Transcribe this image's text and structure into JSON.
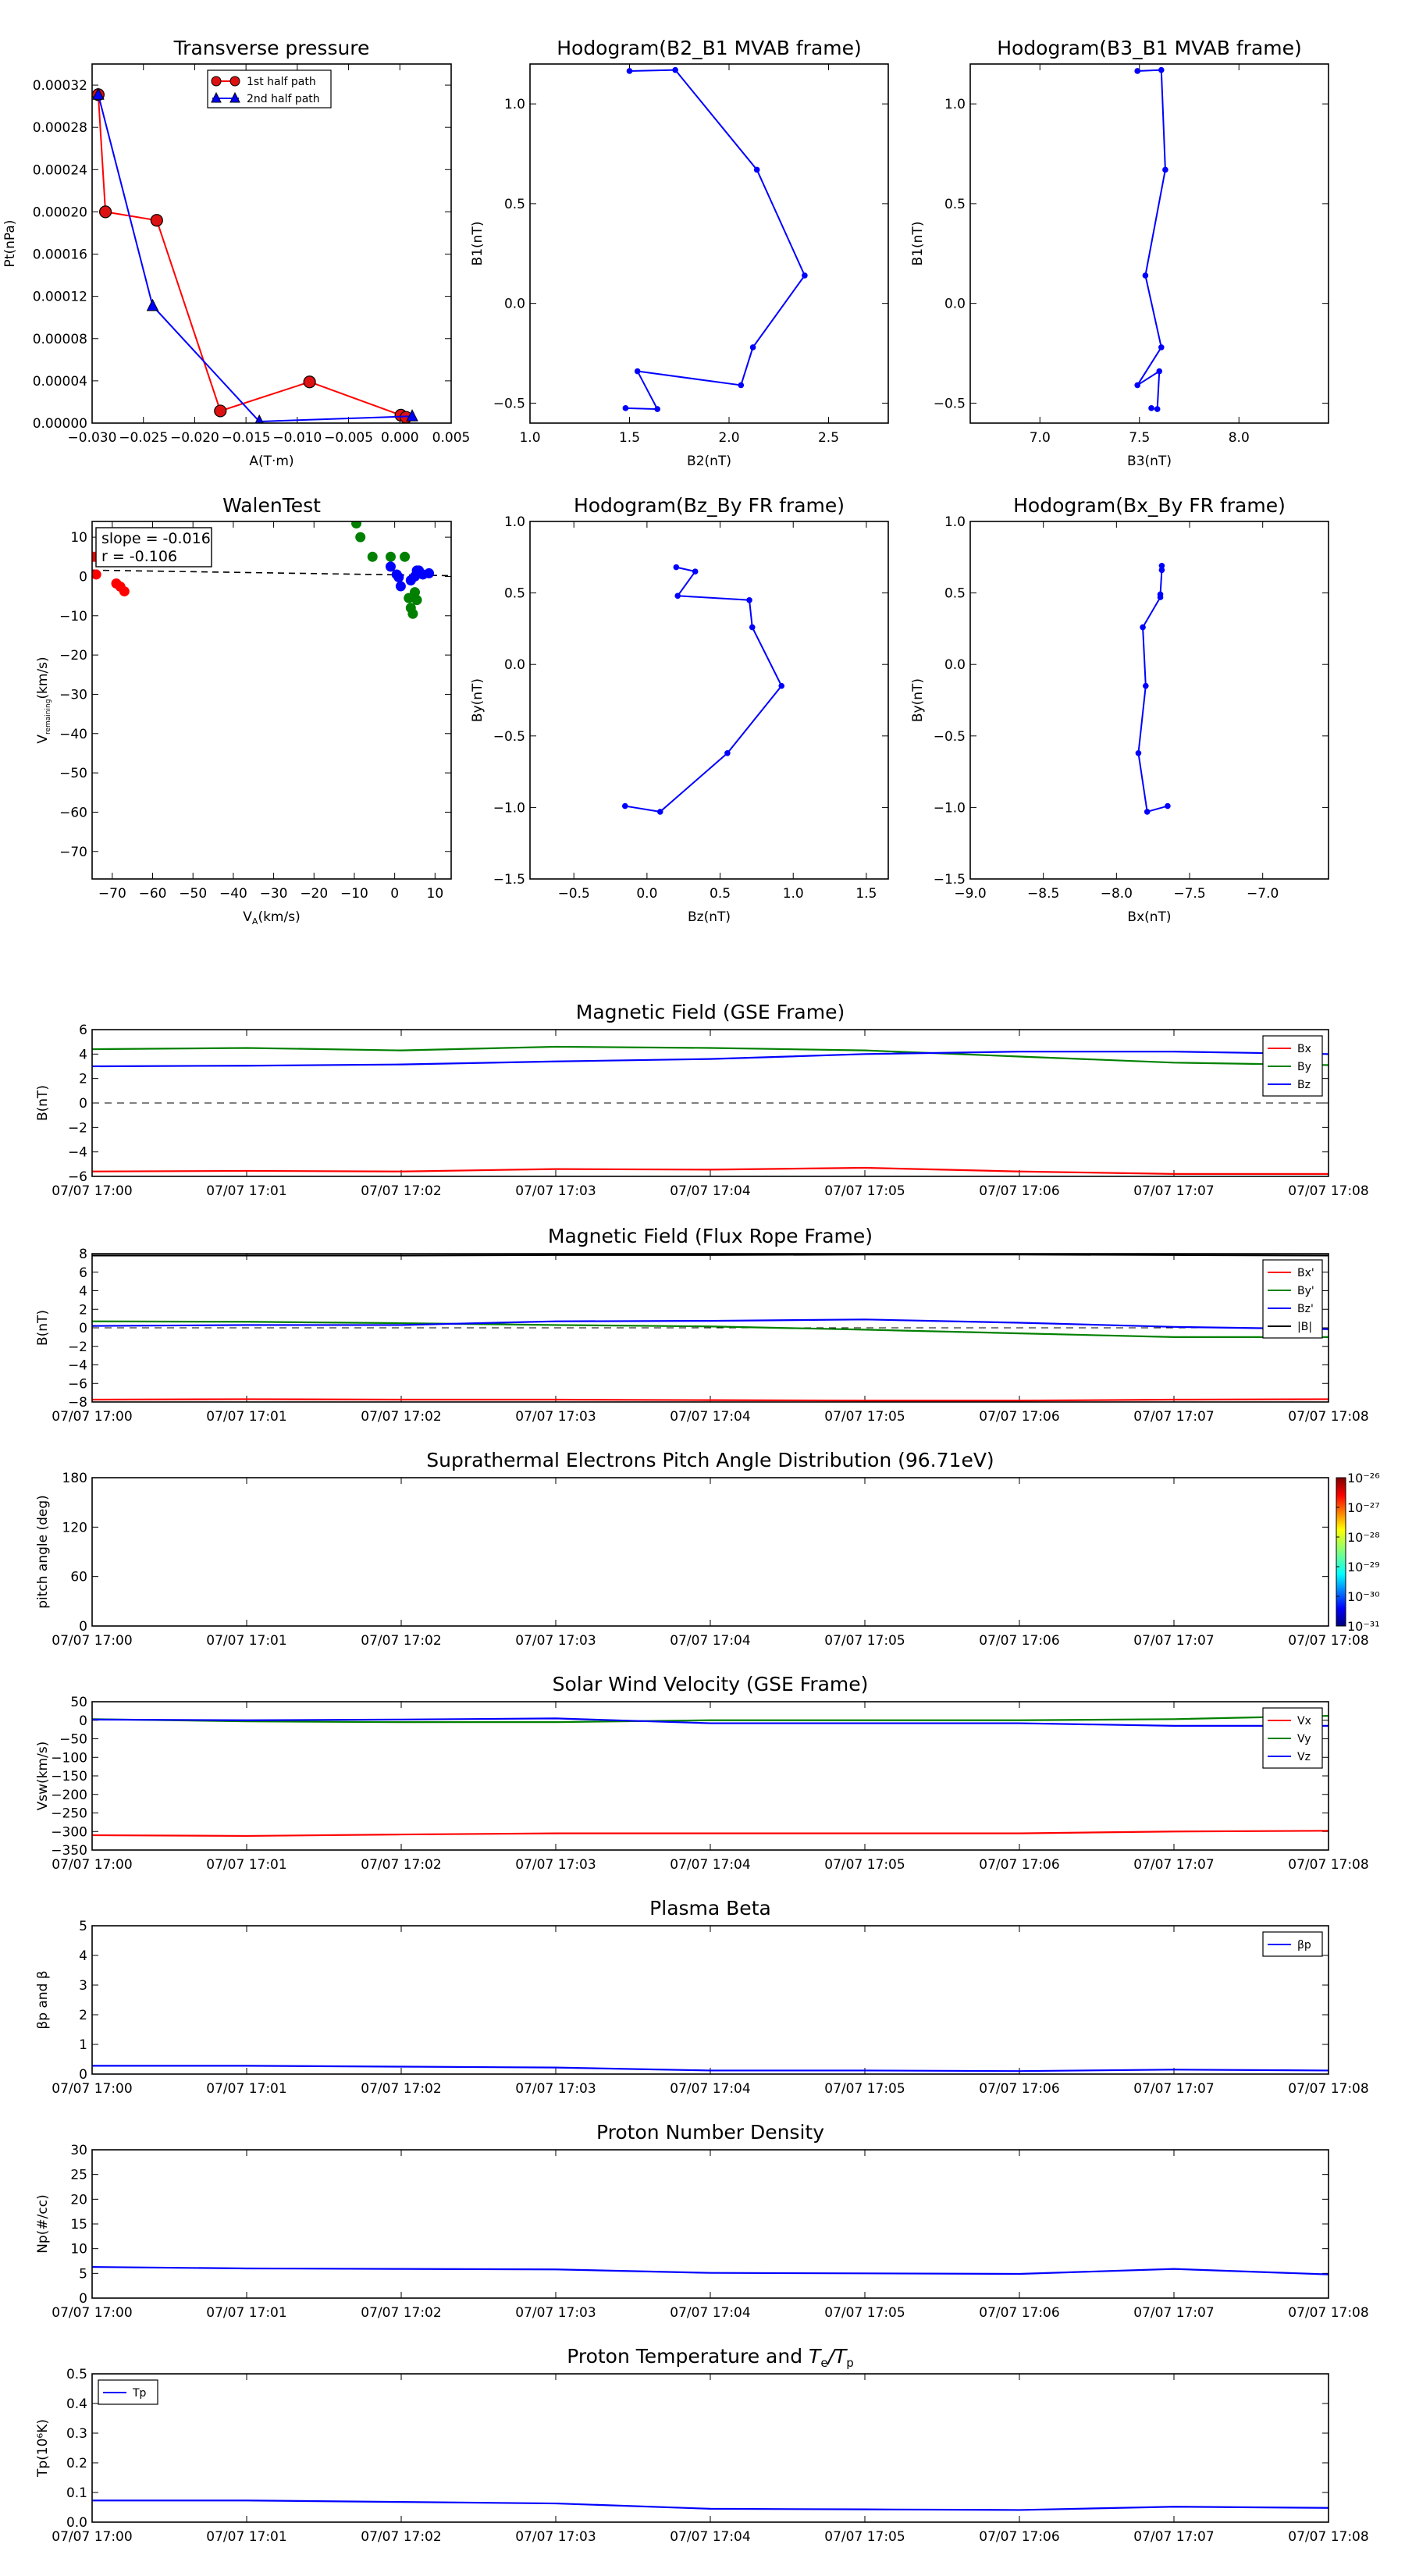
{
  "chart_data": [
    {
      "id": "transverse_pressure",
      "type": "line",
      "title": "Transverse pressure",
      "xlabel": "A(T·m)",
      "ylabel": "Pt(nPa)",
      "xlim": [
        -0.03,
        0.005
      ],
      "ylim": [
        0,
        0.00034
      ],
      "xticks": [
        -0.03,
        -0.025,
        -0.02,
        -0.015,
        -0.01,
        -0.005,
        0.0,
        0.005
      ],
      "xticklabels": [
        "−0.030",
        "−0.025",
        "−0.020",
        "−0.015",
        "−0.010",
        "−0.005",
        "0.000",
        "0.005"
      ],
      "yticks": [
        0,
        4e-05,
        8e-05,
        0.00012,
        0.00016,
        0.0002,
        0.00024,
        0.00028,
        0.00032
      ],
      "yticklabels": [
        "0.00000",
        "0.00004",
        "0.00008",
        "0.00012",
        "0.00016",
        "0.00020",
        "0.00024",
        "0.00028",
        "0.00032"
      ],
      "legend": "top-center",
      "series": [
        {
          "name": "1st half path",
          "color": "#ff0000",
          "marker": "circle",
          "x": [
            -0.0294,
            -0.0287,
            -0.0237,
            -0.0175,
            -0.0088,
            0.0001,
            0.0006
          ],
          "y": [
            0.000311,
            0.0002,
            0.000192,
            1.15e-05,
            3.9e-05,
            7.5e-06,
            5.5e-06
          ]
        },
        {
          "name": "2nd half path",
          "color": "#0000ff",
          "marker": "triangle",
          "x": [
            -0.0294,
            -0.0241,
            -0.0137,
            0.0012
          ],
          "y": [
            0.000311,
            0.000111,
            1.5e-06,
            6.5e-06
          ]
        }
      ]
    },
    {
      "id": "hodo_b2b1",
      "type": "line",
      "title": "Hodogram(B2_B1 MVAB frame)",
      "xlabel": "B2(nT)",
      "ylabel": "B1(nT)",
      "xlim": [
        1.0,
        2.8
      ],
      "ylim": [
        -0.6,
        1.2
      ],
      "xticks": [
        1.0,
        1.5,
        2.0,
        2.5
      ],
      "xticklabels": [
        "1.0",
        "1.5",
        "2.0",
        "2.5"
      ],
      "yticks": [
        -0.5,
        0.0,
        0.5,
        1.0
      ],
      "yticklabels": [
        "−0.5",
        "0.0",
        "0.5",
        "1.0"
      ],
      "series": [
        {
          "color": "#0000ff",
          "x": [
            1.5,
            1.73,
            2.14,
            2.38,
            2.12,
            2.06,
            1.54,
            1.64,
            1.48
          ],
          "y": [
            1.165,
            1.17,
            0.67,
            0.14,
            -0.22,
            -0.41,
            -0.34,
            -0.53,
            -0.525
          ]
        }
      ]
    },
    {
      "id": "hodo_b3b1",
      "type": "line",
      "title": "Hodogram(B3_B1 MVAB frame)",
      "xlabel": "B3(nT)",
      "ylabel": "B1(nT)",
      "xlim": [
        6.65,
        8.45
      ],
      "ylim": [
        -0.6,
        1.2
      ],
      "xticks": [
        7.0,
        7.5,
        8.0
      ],
      "xticklabels": [
        "7.0",
        "7.5",
        "8.0"
      ],
      "yticks": [
        -0.5,
        0.0,
        0.5,
        1.0
      ],
      "yticklabels": [
        "−0.5",
        "0.0",
        "0.5",
        "1.0"
      ],
      "series": [
        {
          "color": "#0000ff",
          "x": [
            7.49,
            7.61,
            7.63,
            7.53,
            7.61,
            7.49,
            7.6,
            7.59,
            7.56
          ],
          "y": [
            1.165,
            1.17,
            0.67,
            0.14,
            -0.22,
            -0.41,
            -0.34,
            -0.53,
            -0.525
          ]
        }
      ]
    },
    {
      "id": "walen",
      "type": "scatter",
      "title": "WalenTest",
      "xlabel": "V_A(km/s)",
      "ylabel": "V_remaining(km/s)",
      "xlim": [
        -75,
        14
      ],
      "ylim": [
        -77,
        14
      ],
      "xticks": [
        -70,
        -60,
        -50,
        -40,
        -30,
        -20,
        -10,
        0,
        10
      ],
      "xticklabels": [
        "−70",
        "−60",
        "−50",
        "−40",
        "−30",
        "−20",
        "−10",
        "0",
        "10"
      ],
      "yticks": [
        -70,
        -60,
        -50,
        -40,
        -30,
        -20,
        -10,
        0,
        10
      ],
      "yticklabels": [
        "−70",
        "−60",
        "−50",
        "−40",
        "−30",
        "−20",
        "−10",
        "0",
        "10"
      ],
      "annotation": [
        "slope = -0.016",
        "r = -0.106"
      ],
      "fit_line": {
        "x": [
          -75,
          14
        ],
        "y": [
          1.6,
          0.2
        ]
      },
      "series": [
        {
          "color": "#ff0000",
          "x": [
            -74.5,
            -74,
            -69,
            -68,
            -67
          ],
          "y": [
            5,
            0.5,
            -1.8,
            -2.6,
            -3.8
          ]
        },
        {
          "color": "#008000",
          "x": [
            -9.5,
            -8.5,
            -5.5,
            -1,
            2.5,
            3.5,
            4,
            4.5,
            5,
            5.5
          ],
          "y": [
            13.5,
            10,
            5,
            5,
            5,
            -5.5,
            -8,
            -9.5,
            -4,
            -6
          ]
        },
        {
          "color": "#0000ff",
          "x": [
            -1,
            0.5,
            1,
            1.5,
            4,
            5,
            5.5,
            6,
            7,
            8.5
          ],
          "y": [
            2.5,
            0.5,
            -0.2,
            -2.5,
            -1,
            0,
            1.5,
            1.5,
            0.5,
            0.8
          ]
        }
      ]
    },
    {
      "id": "hodo_bzby",
      "type": "line",
      "title": "Hodogram(Bz_By FR frame)",
      "xlabel": "Bz(nT)",
      "ylabel": "By(nT)",
      "xlim": [
        -0.8,
        1.65
      ],
      "ylim": [
        -1.5,
        1.0
      ],
      "xticks": [
        -0.5,
        0.0,
        0.5,
        1.0,
        1.5
      ],
      "xticklabels": [
        "−0.5",
        "0.0",
        "0.5",
        "1.0",
        "1.5"
      ],
      "yticks": [
        -1.5,
        -1.0,
        -0.5,
        0.0,
        0.5,
        1.0
      ],
      "yticklabels": [
        "−1.5",
        "−1.0",
        "−0.5",
        "0.0",
        "0.5",
        "1.0"
      ],
      "series": [
        {
          "color": "#0000ff",
          "x": [
            0.2,
            0.33,
            0.21,
            0.7,
            0.72,
            0.92,
            0.55,
            0.09,
            -0.15
          ],
          "y": [
            0.68,
            0.65,
            0.48,
            0.45,
            0.26,
            -0.15,
            -0.62,
            -1.03,
            -0.99
          ]
        }
      ]
    },
    {
      "id": "hodo_bxby",
      "type": "line",
      "title": "Hodogram(Bx_By FR frame)",
      "xlabel": "Bx(nT)",
      "ylabel": "By(nT)",
      "xlim": [
        -9.0,
        -6.55
      ],
      "ylim": [
        -1.5,
        1.0
      ],
      "xticks": [
        -9.0,
        -8.5,
        -8.0,
        -7.5,
        -7.0
      ],
      "xticklabels": [
        "−9.0",
        "−8.5",
        "−8.0",
        "−7.5",
        "−7.0"
      ],
      "yticks": [
        -1.5,
        -1.0,
        -0.5,
        0.0,
        0.5,
        1.0
      ],
      "yticklabels": [
        "−1.5",
        "−1.0",
        "−0.5",
        "0.0",
        "0.5",
        "1.0"
      ],
      "series": [
        {
          "color": "#0000ff",
          "x": [
            -7.69,
            -7.69,
            -7.7,
            -7.7,
            -7.82,
            -7.8,
            -7.85,
            -7.79,
            -7.65
          ],
          "y": [
            0.69,
            0.66,
            0.49,
            0.47,
            0.26,
            -0.15,
            -0.62,
            -1.03,
            -0.99
          ]
        }
      ]
    },
    {
      "id": "mag_gse",
      "type": "line",
      "title": "Magnetic Field (GSE Frame)",
      "ylabel": "B(nT)",
      "ylim": [
        -6,
        6
      ],
      "yticks": [
        -6,
        -4,
        -2,
        0,
        2,
        4,
        6
      ],
      "yticklabels": [
        "−6",
        "−4",
        "−2",
        "0",
        "2",
        "4",
        "6"
      ],
      "zero_line": true,
      "legend": "top-right",
      "series": [
        {
          "name": "Bx",
          "color": "#ff0000",
          "values": [
            -5.6,
            -5.55,
            -5.6,
            -5.4,
            -5.45,
            -5.3,
            -5.6,
            -5.8,
            -5.8
          ]
        },
        {
          "name": "By",
          "color": "#008000",
          "values": [
            4.4,
            4.5,
            4.3,
            4.6,
            4.5,
            4.3,
            3.8,
            3.3,
            3.1
          ]
        },
        {
          "name": "Bz",
          "color": "#0000ff",
          "values": [
            3.0,
            3.05,
            3.15,
            3.4,
            3.6,
            4.0,
            4.2,
            4.2,
            4.0
          ]
        }
      ]
    },
    {
      "id": "mag_fr",
      "type": "line",
      "title": "Magnetic Field (Flux Rope Frame)",
      "ylabel": "B(nT)",
      "ylim": [
        -8,
        8
      ],
      "yticks": [
        -8,
        -6,
        -4,
        -2,
        0,
        2,
        4,
        6,
        8
      ],
      "yticklabels": [
        "−8",
        "−6",
        "−4",
        "−2",
        "0",
        "2",
        "4",
        "6",
        "8"
      ],
      "zero_line": true,
      "legend": "top-right",
      "series": [
        {
          "name": "Bx'",
          "color": "#ff0000",
          "values": [
            -7.75,
            -7.7,
            -7.75,
            -7.75,
            -7.8,
            -7.85,
            -7.85,
            -7.75,
            -7.7
          ]
        },
        {
          "name": "By'",
          "color": "#008000",
          "values": [
            0.7,
            0.65,
            0.5,
            0.3,
            0.15,
            -0.2,
            -0.6,
            -1.0,
            -1.0
          ]
        },
        {
          "name": "Bz'",
          "color": "#0000ff",
          "values": [
            0.2,
            0.3,
            0.3,
            0.7,
            0.75,
            0.9,
            0.55,
            0.1,
            -0.15
          ]
        },
        {
          "name": "|B|",
          "color": "#000000",
          "values": [
            7.8,
            7.8,
            7.8,
            7.85,
            7.85,
            7.9,
            7.9,
            7.85,
            7.8
          ]
        }
      ]
    },
    {
      "id": "pad",
      "type": "heatmap",
      "title": "Suprathermal Electrons Pitch Angle Distribution (96.71eV)",
      "ylabel": "pitch angle (deg)",
      "ylim": [
        0,
        180
      ],
      "yticks": [
        0,
        60,
        120,
        180
      ],
      "yticklabels": [
        "0",
        "60",
        "120",
        "180"
      ],
      "colorbar_labels": [
        "10⁻²⁶",
        "10⁻²⁷",
        "10⁻²⁸",
        "10⁻²⁹",
        "10⁻³⁰",
        "10⁻³¹"
      ]
    },
    {
      "id": "vsw",
      "type": "line",
      "title": "Solar Wind Velocity (GSE Frame)",
      "ylabel": "Vsw(km/s)",
      "ylim": [
        -350,
        50
      ],
      "yticks": [
        -350,
        -300,
        -250,
        -200,
        -150,
        -100,
        -50,
        0,
        50
      ],
      "yticklabels": [
        "−350",
        "−300",
        "−250",
        "−200",
        "−150",
        "−100",
        "−50",
        "0",
        "50"
      ],
      "legend": "top-right",
      "series": [
        {
          "name": "Vx",
          "color": "#ff0000",
          "values": [
            -310,
            -312,
            -308,
            -305,
            -305,
            -305,
            -305,
            -300,
            -298
          ]
        },
        {
          "name": "Vy",
          "color": "#008000",
          "values": [
            3,
            -3,
            -5,
            -5,
            0,
            0,
            0,
            3,
            12
          ]
        },
        {
          "name": "Vz",
          "color": "#0000ff",
          "values": [
            2,
            0,
            2,
            5,
            -8,
            -8,
            -8,
            -15,
            -15
          ]
        }
      ]
    },
    {
      "id": "beta",
      "type": "line",
      "title": "Plasma Beta",
      "ylabel": "βp and β",
      "ylim": [
        0,
        5
      ],
      "yticks": [
        0,
        1,
        2,
        3,
        4,
        5
      ],
      "yticklabels": [
        "0",
        "1",
        "2",
        "3",
        "4",
        "5"
      ],
      "legend": "top-right",
      "series": [
        {
          "name": "βp",
          "color": "#0000ff",
          "values": [
            0.28,
            0.28,
            0.25,
            0.22,
            0.12,
            0.12,
            0.1,
            0.15,
            0.12
          ]
        }
      ]
    },
    {
      "id": "np",
      "type": "line",
      "title": "Proton Number Density",
      "ylabel": "Np(#/cc)",
      "ylim": [
        0,
        30
      ],
      "yticks": [
        0,
        5,
        10,
        15,
        20,
        25,
        30
      ],
      "yticklabels": [
        "0",
        "5",
        "10",
        "15",
        "20",
        "25",
        "30"
      ],
      "series": [
        {
          "color": "#0000ff",
          "values": [
            6.3,
            6.0,
            5.9,
            5.8,
            5.1,
            5.0,
            4.9,
            5.9,
            4.8
          ]
        }
      ]
    },
    {
      "id": "tp",
      "type": "line",
      "title": "Proton Temperature and Te/Tp",
      "ylabel": "Tp(10⁶K)",
      "ylim": [
        0,
        0.5
      ],
      "yticks": [
        0,
        0.1,
        0.2,
        0.3,
        0.4,
        0.5
      ],
      "yticklabels": [
        "0.0",
        "0.1",
        "0.2",
        "0.3",
        "0.4",
        "0.5"
      ],
      "legend": "top-left",
      "series": [
        {
          "name": "Tp",
          "color": "#0000ff",
          "values": [
            0.073,
            0.073,
            0.068,
            0.063,
            0.045,
            0.043,
            0.041,
            0.052,
            0.048
          ]
        }
      ]
    }
  ],
  "time_axis": {
    "x": [
      "07/07 17:00",
      "07/07 17:01",
      "07/07 17:02",
      "07/07 17:03",
      "07/07 17:04",
      "07/07 17:05",
      "07/07 17:06",
      "07/07 17:07",
      "07/07 17:08"
    ]
  }
}
